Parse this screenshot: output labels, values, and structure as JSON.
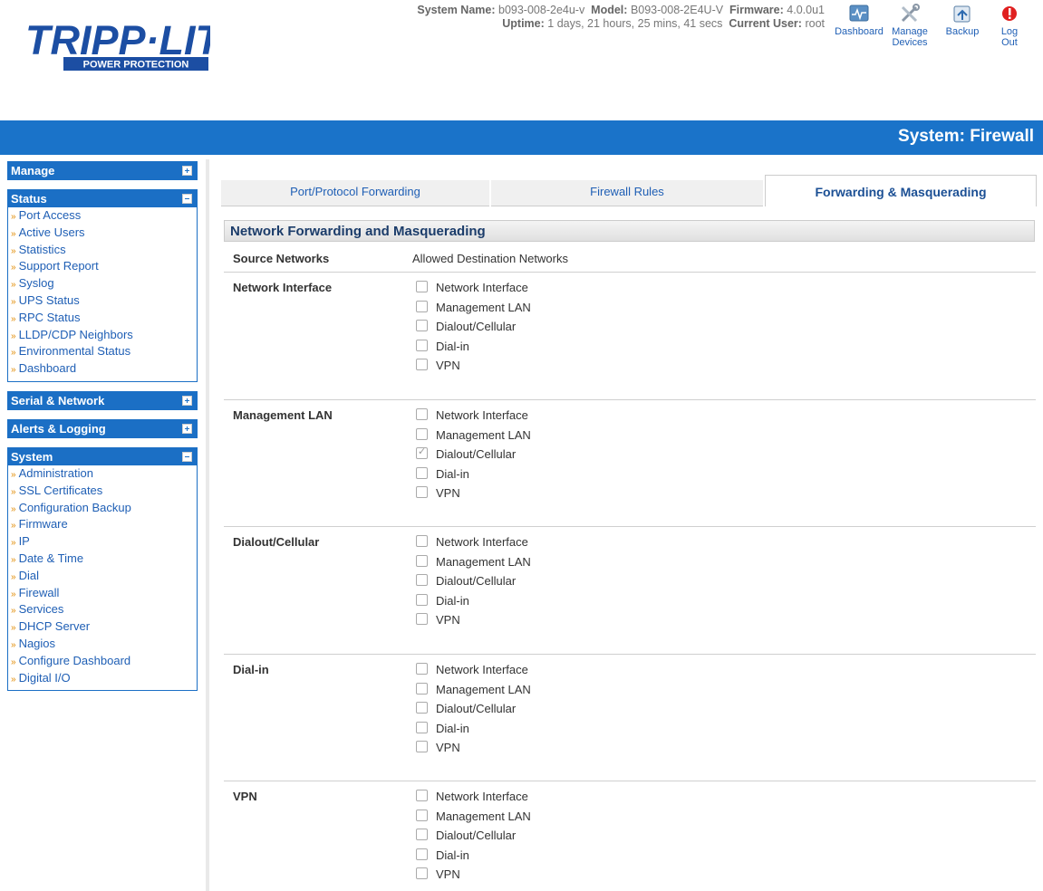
{
  "logo": {
    "brand": "TRIPP·LITE",
    "tagline": "POWER PROTECTION"
  },
  "system_info": {
    "system_name_label": "System Name:",
    "system_name": "b093-008-2e4u-v",
    "model_label": "Model:",
    "model": "B093-008-2E4U-V",
    "firmware_label": "Firmware:",
    "firmware": "4.0.0u1",
    "uptime_label": "Uptime:",
    "uptime": "1 days, 21 hours, 25 mins, 41 secs",
    "current_user_label": "Current User:",
    "current_user": "root"
  },
  "top_nav": [
    {
      "label": "Dashboard",
      "icon": "dashboard-icon"
    },
    {
      "label": "Manage\nDevices",
      "icon": "wrench-icon"
    },
    {
      "label": "Backup",
      "icon": "backup-icon"
    },
    {
      "label": "Log Out",
      "icon": "logout-icon"
    }
  ],
  "page_title": "System: Firewall",
  "sidebar": {
    "manage": {
      "title": "Manage"
    },
    "status": {
      "title": "Status",
      "items": [
        "Port Access",
        "Active Users",
        "Statistics",
        "Support Report",
        "Syslog",
        "UPS Status",
        "RPC Status",
        "LLDP/CDP Neighbors",
        "Environmental Status",
        "Dashboard"
      ]
    },
    "serial_network": {
      "title": "Serial & Network"
    },
    "alerts_logging": {
      "title": "Alerts & Logging"
    },
    "system": {
      "title": "System",
      "items": [
        "Administration",
        "SSL Certificates",
        "Configuration Backup",
        "Firmware",
        "IP",
        "Date & Time",
        "Dial",
        "Firewall",
        "Services",
        "DHCP Server",
        "Nagios",
        "Configure Dashboard",
        "Digital I/O"
      ]
    }
  },
  "tabs": [
    "Port/Protocol Forwarding",
    "Firewall Rules",
    "Forwarding & Masquerading"
  ],
  "section_title": "Network Forwarding and Masquerading",
  "columns": {
    "source": "Source Networks",
    "allowed": "Allowed Destination Networks"
  },
  "option_labels": [
    "Network Interface",
    "Management LAN",
    "Dialout/Cellular",
    "Dial-in",
    "VPN"
  ],
  "groups": [
    {
      "name": "Network Interface",
      "checked": [
        false,
        false,
        false,
        false,
        false
      ]
    },
    {
      "name": "Management LAN",
      "checked": [
        false,
        false,
        true,
        false,
        false
      ]
    },
    {
      "name": "Dialout/Cellular",
      "checked": [
        false,
        false,
        false,
        false,
        false
      ]
    },
    {
      "name": "Dial-in",
      "checked": [
        false,
        false,
        false,
        false,
        false
      ]
    },
    {
      "name": "VPN",
      "checked": [
        false,
        false,
        false,
        false,
        false
      ]
    }
  ],
  "colors": {
    "brand_blue": "#1a73c9",
    "link_blue": "#1f5fb5",
    "logo_blue": "#1c4ea3"
  }
}
